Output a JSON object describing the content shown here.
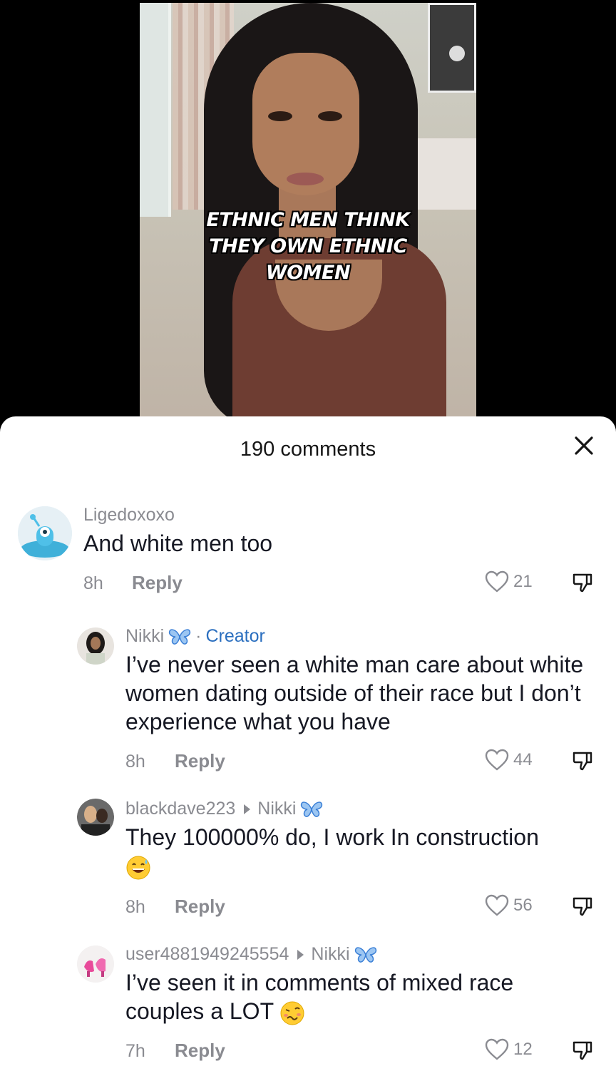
{
  "video": {
    "caption": "ETHNIC MEN THINK\nTHEY OWN ETHNIC\nWOMEN"
  },
  "sheet": {
    "title": "190 comments"
  },
  "comments": [
    {
      "username": "Ligedoxoxo",
      "text": "And white men too",
      "time": "8h",
      "reply_label": "Reply",
      "likes": "21"
    },
    {
      "username": "Nikki",
      "creator_label": "Creator",
      "separator": "·",
      "text": "I’ve never seen a white man care about white women dating outside of their race but I don’t experience what you have",
      "time": "8h",
      "reply_label": "Reply",
      "likes": "44"
    },
    {
      "username": "blackdave223",
      "reply_to": "Nikki",
      "text": "They 100000% do, I work In construction",
      "time": "8h",
      "reply_label": "Reply",
      "likes": "56"
    },
    {
      "username": "user4881949245554",
      "reply_to": "Nikki",
      "text": "I’ve seen it in comments of mixed race couples a LOT",
      "time": "7h",
      "reply_label": "Reply",
      "likes": "12"
    }
  ],
  "colors": {
    "creator": "#2b6fbf",
    "secondary_text": "#8a8b91",
    "butterfly": "#3a7fd6"
  }
}
